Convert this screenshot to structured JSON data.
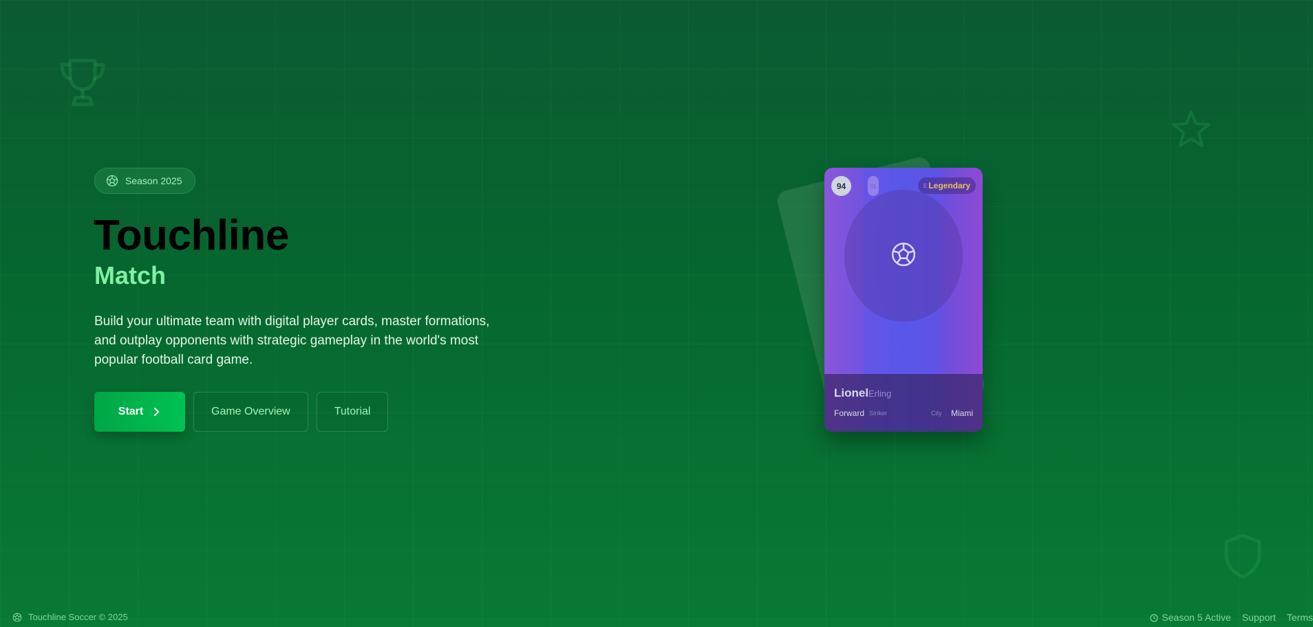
{
  "badge": {
    "label": "Season 2025",
    "icon": "soccer-ball-icon"
  },
  "hero": {
    "title": "Touchline",
    "subtitle": "Match",
    "description": "Build your ultimate team with digital player cards, master formations, and outplay opponents with strategic gameplay in the world's most popular football card game."
  },
  "actions": {
    "start": "Start",
    "overview": "Game Overview",
    "tutorial": "Tutorial"
  },
  "card": {
    "rating": "94",
    "rating_ghost": "91",
    "rarity_ghost": "E",
    "rarity": "Legendary",
    "name": "Lionel",
    "name_ghost": "Erling",
    "position": "Forward",
    "position_ghost": "Striker",
    "club_ghost": "City",
    "club": "Miami"
  },
  "footer": {
    "copyright": "Touchline Soccer © 2025",
    "status": "Season 5 Active",
    "support": "Support",
    "terms": "Terms"
  },
  "colors": {
    "background": "#06672f",
    "accent": "#00c253",
    "subtitle": "#7ff0a5",
    "rarity": "#e6c25a",
    "card": "#6b4fdc"
  },
  "decorations": [
    "trophy-icon",
    "star-icon",
    "shield-icon"
  ]
}
